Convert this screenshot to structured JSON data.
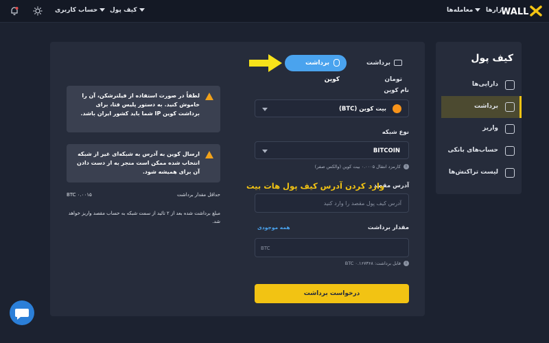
{
  "topbar": {
    "logo_text": "WALLEX",
    "markets": "بازارها",
    "trades": "معامله‌ها",
    "wallet": "کیف پول",
    "account": "حساب کاربری"
  },
  "sidebar": {
    "title": "کیف پول",
    "items": [
      {
        "label": "دارایی‌ها",
        "icon": "wallet-icon"
      },
      {
        "label": "برداشت",
        "icon": "withdraw-icon"
      },
      {
        "label": "واریز",
        "icon": "deposit-icon"
      },
      {
        "label": "حساب‌های بانکی",
        "icon": "bank-card-icon"
      },
      {
        "label": "لیست تراکنش‌ها",
        "icon": "transactions-icon"
      }
    ]
  },
  "tabs": {
    "coin": "برداشت کوین",
    "toman": "برداشت تومان"
  },
  "form": {
    "coin_label": "نام کوین",
    "coin_value": "بیت کوین (BTC)",
    "network_label": "نوع شبکه",
    "network_value": "BITCOIN",
    "network_hint": "کارمزد انتقال ۰.۰۰۰۵ بیت کوین (والکس صفر)",
    "address_label": "آدرس مقصد",
    "address_placeholder": "آدرس کیف پول مقصد را وارد کنید",
    "annotation": "وارد کردن آدرس کیف پول هات بیت",
    "amount_label": "مقدار برداشت",
    "all_balance": "همه موجودی",
    "amount_unit": "BTC",
    "amount_hint": "قابل برداشت: ۰.۱۶۷۳۶۸ BTC",
    "submit": "درخواست برداشت"
  },
  "info": {
    "warning1": "لطفاً در صورت استفاده از فیلترشکن، آن را خاموش کنید. به دستور پلیس فتا، برای برداشت کوین IP شما باید کشور ایران باشد.",
    "warning2": "ارسال کوین به آدرس به شبکه‌ای غیر از شبکه انتخاب شده ممکن است منجر به از دست دادن آن برای همیشه شود.",
    "min_label": "حداقل مقدار برداشت",
    "min_value": "۰.۰۰۱۵ BTC",
    "note": "مبلغ برداشت شده بعد از ۲ تائید از سمت شبکه به حساب مقصد واریز خواهد شد."
  },
  "colors": {
    "accent": "#f2c313",
    "tab_active": "#4aa3ee",
    "panel": "#262c3b",
    "background": "#1c2230"
  }
}
